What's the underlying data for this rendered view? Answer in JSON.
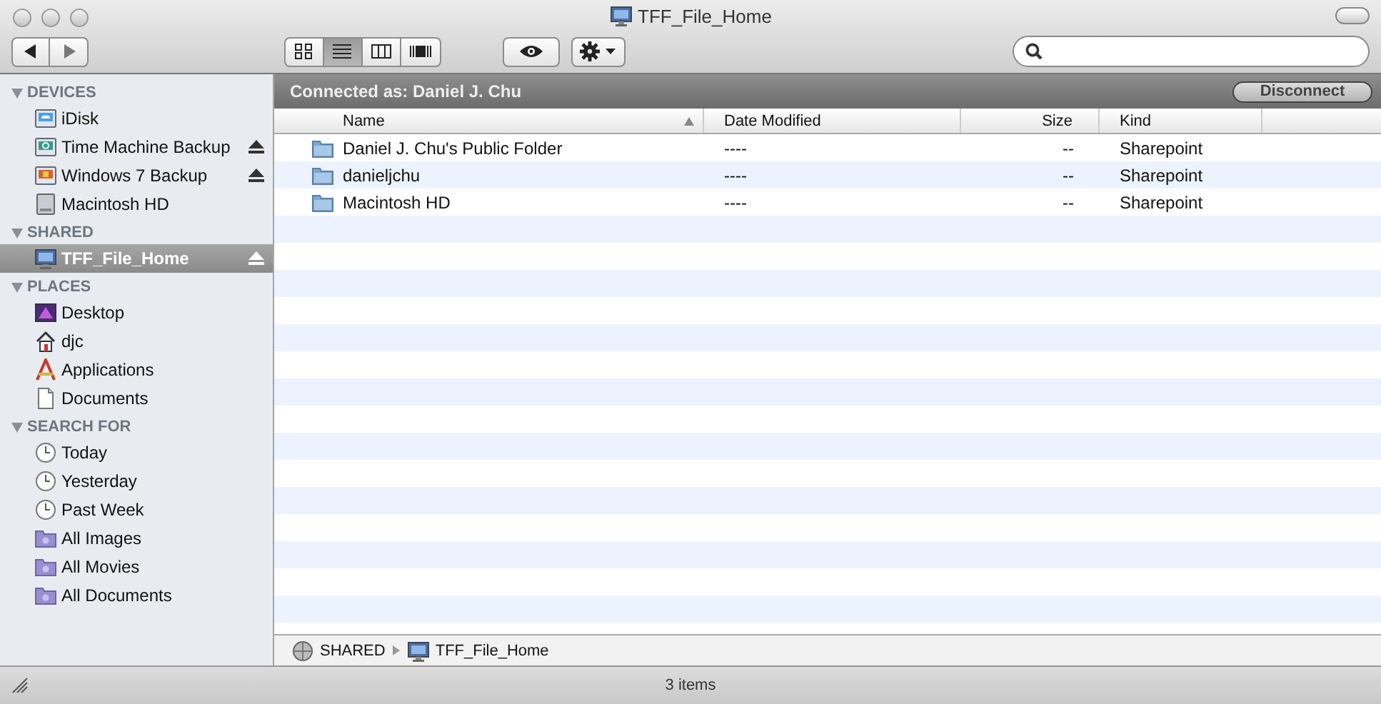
{
  "window": {
    "title": "TFF_File_Home"
  },
  "toolbar": {
    "view_buttons": [
      {
        "kind": "icons",
        "selected": false
      },
      {
        "kind": "list",
        "selected": true
      },
      {
        "kind": "columns",
        "selected": false
      },
      {
        "kind": "coverflow",
        "selected": false
      }
    ]
  },
  "sidebar": {
    "sections": [
      {
        "title": "DEVICES",
        "expanded": true,
        "items": [
          {
            "label": "iDisk",
            "kind": "idisk",
            "selected": false,
            "eject": false
          },
          {
            "label": "Time Machine Backup",
            "kind": "backup-disk",
            "selected": false,
            "eject": true
          },
          {
            "label": "Windows 7 Backup",
            "kind": "windows-disk",
            "selected": false,
            "eject": true
          },
          {
            "label": "Macintosh HD",
            "kind": "hard-disk",
            "selected": false,
            "eject": false
          }
        ]
      },
      {
        "title": "SHARED",
        "expanded": true,
        "items": [
          {
            "label": "TFF_File_Home",
            "kind": "monitor",
            "selected": true,
            "eject": true
          }
        ]
      },
      {
        "title": "PLACES",
        "expanded": true,
        "items": [
          {
            "label": "Desktop",
            "kind": "desktop",
            "selected": false,
            "eject": false
          },
          {
            "label": "djc",
            "kind": "home",
            "selected": false,
            "eject": false
          },
          {
            "label": "Applications",
            "kind": "applications",
            "selected": false,
            "eject": false
          },
          {
            "label": "Documents",
            "kind": "document",
            "selected": false,
            "eject": false
          }
        ]
      },
      {
        "title": "SEARCH FOR",
        "expanded": true,
        "items": [
          {
            "label": "Today",
            "kind": "clock",
            "selected": false,
            "eject": false
          },
          {
            "label": "Yesterday",
            "kind": "clock",
            "selected": false,
            "eject": false
          },
          {
            "label": "Past Week",
            "kind": "clock",
            "selected": false,
            "eject": false
          },
          {
            "label": "All Images",
            "kind": "smart-folder",
            "selected": false,
            "eject": false
          },
          {
            "label": "All Movies",
            "kind": "smart-folder",
            "selected": false,
            "eject": false
          },
          {
            "label": "All Documents",
            "kind": "smart-folder",
            "selected": false,
            "eject": false
          }
        ]
      }
    ]
  },
  "connection_bar": {
    "text": "Connected as: Daniel J. Chu",
    "button": "Disconnect"
  },
  "table": {
    "columns": [
      {
        "label": "Name",
        "sorted": true
      },
      {
        "label": "Date Modified",
        "sorted": false
      },
      {
        "label": "Size",
        "sorted": false
      },
      {
        "label": "Kind",
        "sorted": false
      }
    ],
    "rows": [
      {
        "name": "Daniel J. Chu's Public Folder",
        "date": "----",
        "size": "--",
        "kind": "Sharepoint"
      },
      {
        "name": "danieljchu",
        "date": "----",
        "size": "--",
        "kind": "Sharepoint"
      },
      {
        "name": "Macintosh HD",
        "date": "----",
        "size": "--",
        "kind": "Sharepoint"
      }
    ]
  },
  "path_bar": [
    {
      "label": "SHARED",
      "kind": "network"
    },
    {
      "label": "TFF_File_Home",
      "kind": "monitor"
    }
  ],
  "status_bar": {
    "text": "3 items"
  }
}
